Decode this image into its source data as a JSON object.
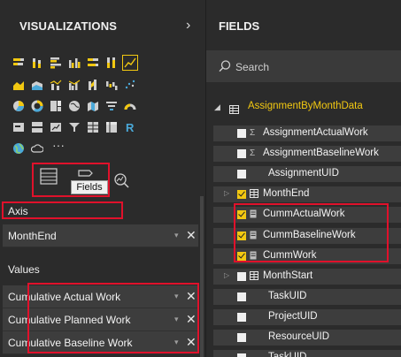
{
  "visualizations": {
    "title": "VISUALIZATIONS",
    "collapse_glyph": "›",
    "icons": [
      "stacked-bar-icon",
      "stacked-column-icon",
      "clustered-bar-icon",
      "clustered-column-icon",
      "100-stacked-bar-icon",
      "100-stacked-column-icon",
      "line-chart-icon",
      "area-chart-icon",
      "stacked-area-icon",
      "line-column-icon",
      "line-clustered-column-icon",
      "ribbon-chart-icon",
      "waterfall-icon",
      "scatter-icon",
      "pie-chart-icon",
      "donut-chart-icon",
      "treemap-icon",
      "map-icon",
      "filled-map-icon",
      "funnel-icon",
      "gauge-icon",
      "card-icon",
      "multi-row-card-icon",
      "kpi-icon",
      "slicer-icon",
      "table-icon",
      "matrix-icon",
      "r-visual-icon",
      "globe-icon",
      "cloud-icon"
    ],
    "r_label": "R",
    "more_label": "···",
    "tabs": {
      "fields_tooltip": "Fields"
    },
    "axis_label": "Axis",
    "axis_items": [
      "MonthEnd"
    ],
    "values_label": "Values",
    "value_items": [
      "Cumulative Actual Work",
      "Cumulative Planned Work",
      "Cumulative Baseline Work"
    ],
    "remove_glyph": "✕",
    "dropdown_glyph": "▾"
  },
  "fields": {
    "title": "FIELDS",
    "search_placeholder": "Search",
    "table_name": "AssignmentByMonthData",
    "rows": [
      {
        "label": "AssignmentActualWork",
        "icon": "sigma",
        "checked": false,
        "expandable": false
      },
      {
        "label": "AssignmentBaselineWork",
        "icon": "sigma",
        "checked": false,
        "expandable": false
      },
      {
        "label": "AssignmentUID",
        "icon": "none",
        "checked": false,
        "expandable": false
      },
      {
        "label": "MonthEnd",
        "icon": "hierarchy",
        "checked": true,
        "expandable": true
      },
      {
        "label": "CummActualWork",
        "icon": "measure",
        "checked": true,
        "expandable": false
      },
      {
        "label": "CummBaselineWork",
        "icon": "measure",
        "checked": true,
        "expandable": false
      },
      {
        "label": "CummWork",
        "icon": "measure",
        "checked": true,
        "expandable": false
      },
      {
        "label": "MonthStart",
        "icon": "hierarchy",
        "checked": false,
        "expandable": true
      },
      {
        "label": "TaskUID",
        "icon": "none",
        "checked": false,
        "expandable": false
      },
      {
        "label": "ProjectUID",
        "icon": "none",
        "checked": false,
        "expandable": false
      },
      {
        "label": "ResourceUID",
        "icon": "none",
        "checked": false,
        "expandable": false
      },
      {
        "label": "TaskUID",
        "icon": "none",
        "checked": false,
        "expandable": false
      }
    ]
  },
  "colors": {
    "pane_bg": "#2b2b2b",
    "accent_yellow": "#f2c811",
    "highlight_red": "#e0112b"
  }
}
